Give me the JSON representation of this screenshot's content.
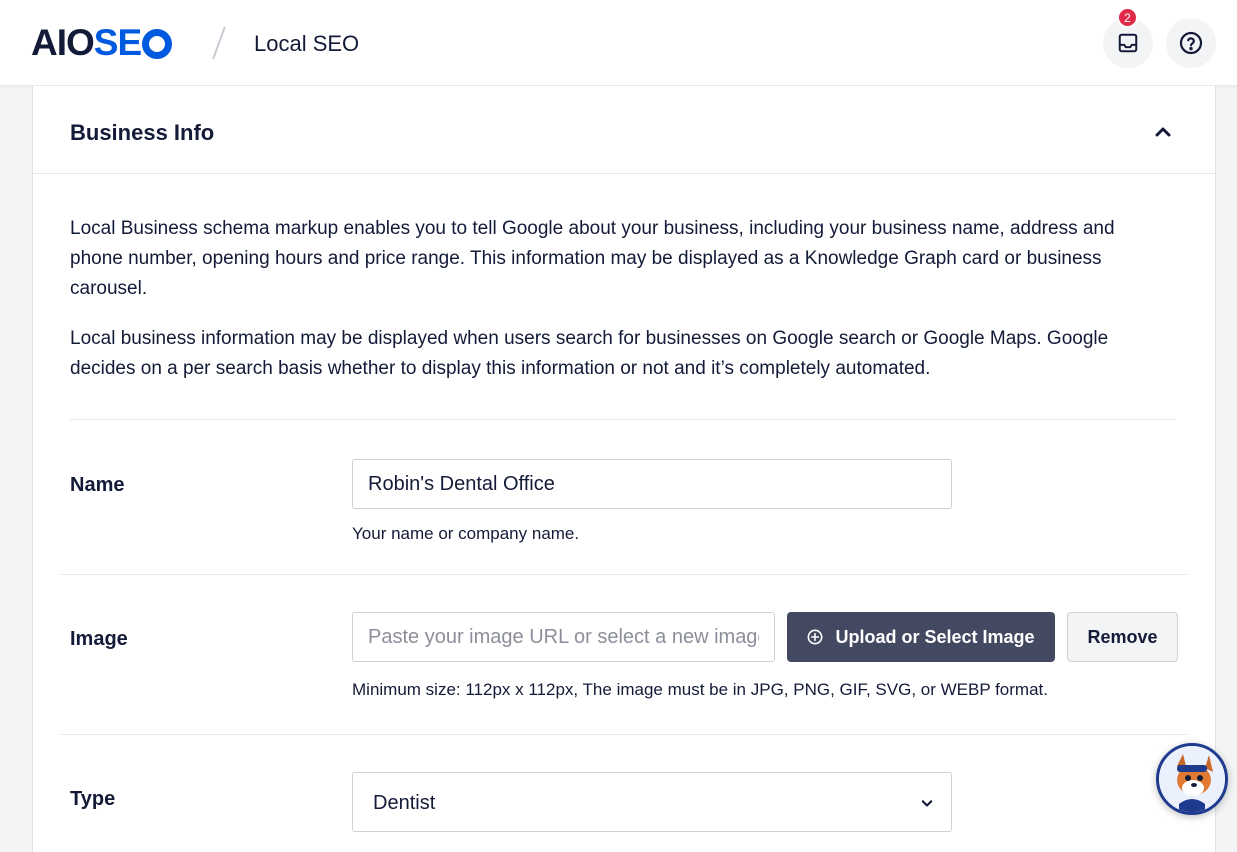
{
  "header": {
    "logo_part1": "AIO",
    "logo_part2": "SE",
    "breadcrumb": "Local SEO",
    "notifications_count": "2",
    "inbox_icon": "inbox-icon",
    "help_icon": "help-circle-icon"
  },
  "card": {
    "title": "Business Info",
    "collapse_icon": "chevron-up-icon",
    "paragraph1": "Local Business schema markup enables you to tell Google about your business, including your business name, address and phone number, opening hours and price range. This information may be displayed as a Knowledge Graph card or business carousel.",
    "paragraph2": "Local business information may be displayed when users search for businesses on Google search or Google Maps. Google decides on a per search basis whether to display this information or not and it’s completely automated."
  },
  "name_row": {
    "label": "Name",
    "value": "Robin's Dental Office",
    "hint": "Your name or company name."
  },
  "image_row": {
    "label": "Image",
    "placeholder": "Paste your image URL or select a new image",
    "upload_label": "Upload or Select Image",
    "remove_label": "Remove",
    "hint": "Minimum size: 112px x 112px, The image must be in JPG, PNG, GIF, SVG, or WEBP format."
  },
  "type_row": {
    "label": "Type",
    "selected": "Dentist"
  },
  "colors": {
    "brand_blue": "#005ae0",
    "dark_button": "#434960",
    "badge_red": "#df2a4a"
  }
}
